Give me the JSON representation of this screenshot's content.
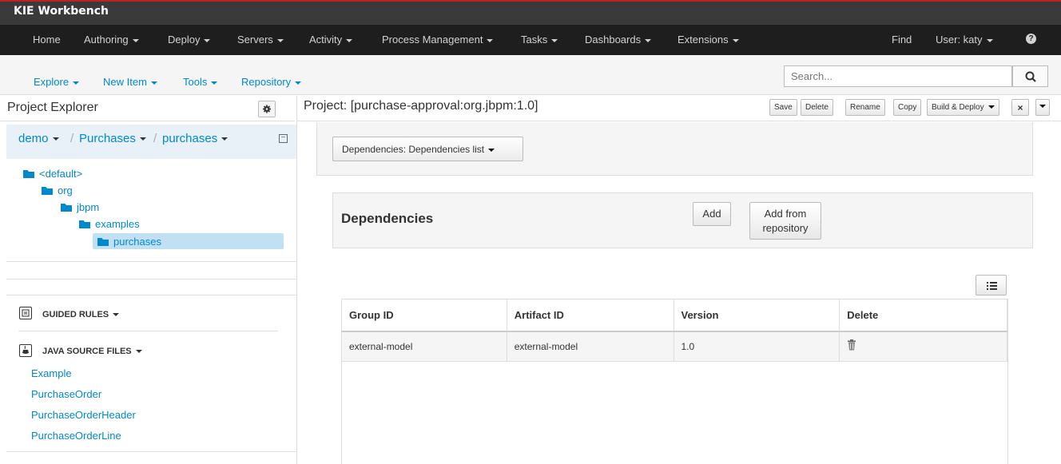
{
  "app": {
    "title": "KIE Workbench"
  },
  "main_nav": {
    "items": [
      "Home",
      "Authoring",
      "Deploy",
      "Servers",
      "Activity",
      "Process Management",
      "Tasks",
      "Dashboards",
      "Extensions"
    ],
    "find": "Find",
    "user": "User: katy"
  },
  "sub_nav": {
    "items": [
      "Explore",
      "New Item",
      "Tools",
      "Repository"
    ],
    "search_placeholder": "Search..."
  },
  "explorer": {
    "title": "Project Explorer",
    "breadcrumb": [
      "demo",
      "Purchases",
      "purchases"
    ],
    "tree": [
      "<default>",
      "org",
      "jbpm",
      "examples",
      "purchases"
    ],
    "categories": [
      {
        "label": "GUIDED RULES",
        "icon": "guided-rules-icon"
      },
      {
        "label": "JAVA SOURCE FILES",
        "icon": "java-file-icon"
      }
    ],
    "java_files": [
      "Example",
      "PurchaseOrder",
      "PurchaseOrderHeader",
      "PurchaseOrderLine"
    ]
  },
  "project": {
    "title": "Project: [purchase-approval:org.jbpm:1.0]",
    "toolbar": {
      "save": "Save",
      "delete": "Delete",
      "rename": "Rename",
      "copy": "Copy",
      "build_deploy": "Build & Deploy"
    },
    "view_selector": "Dependencies: Dependencies list",
    "dependencies": {
      "title": "Dependencies",
      "add": "Add",
      "add_from_repo_line1": "Add from",
      "add_from_repo_line2": "repository",
      "columns": [
        "Group ID",
        "Artifact ID",
        "Version",
        "Delete"
      ],
      "rows": [
        {
          "group_id": "external-model",
          "artifact_id": "external-model",
          "version": "1.0"
        }
      ]
    }
  },
  "colors": {
    "link": "#0088ce",
    "nav_bg": "#1e1e1e",
    "brand_bg": "#3a3a3a"
  }
}
